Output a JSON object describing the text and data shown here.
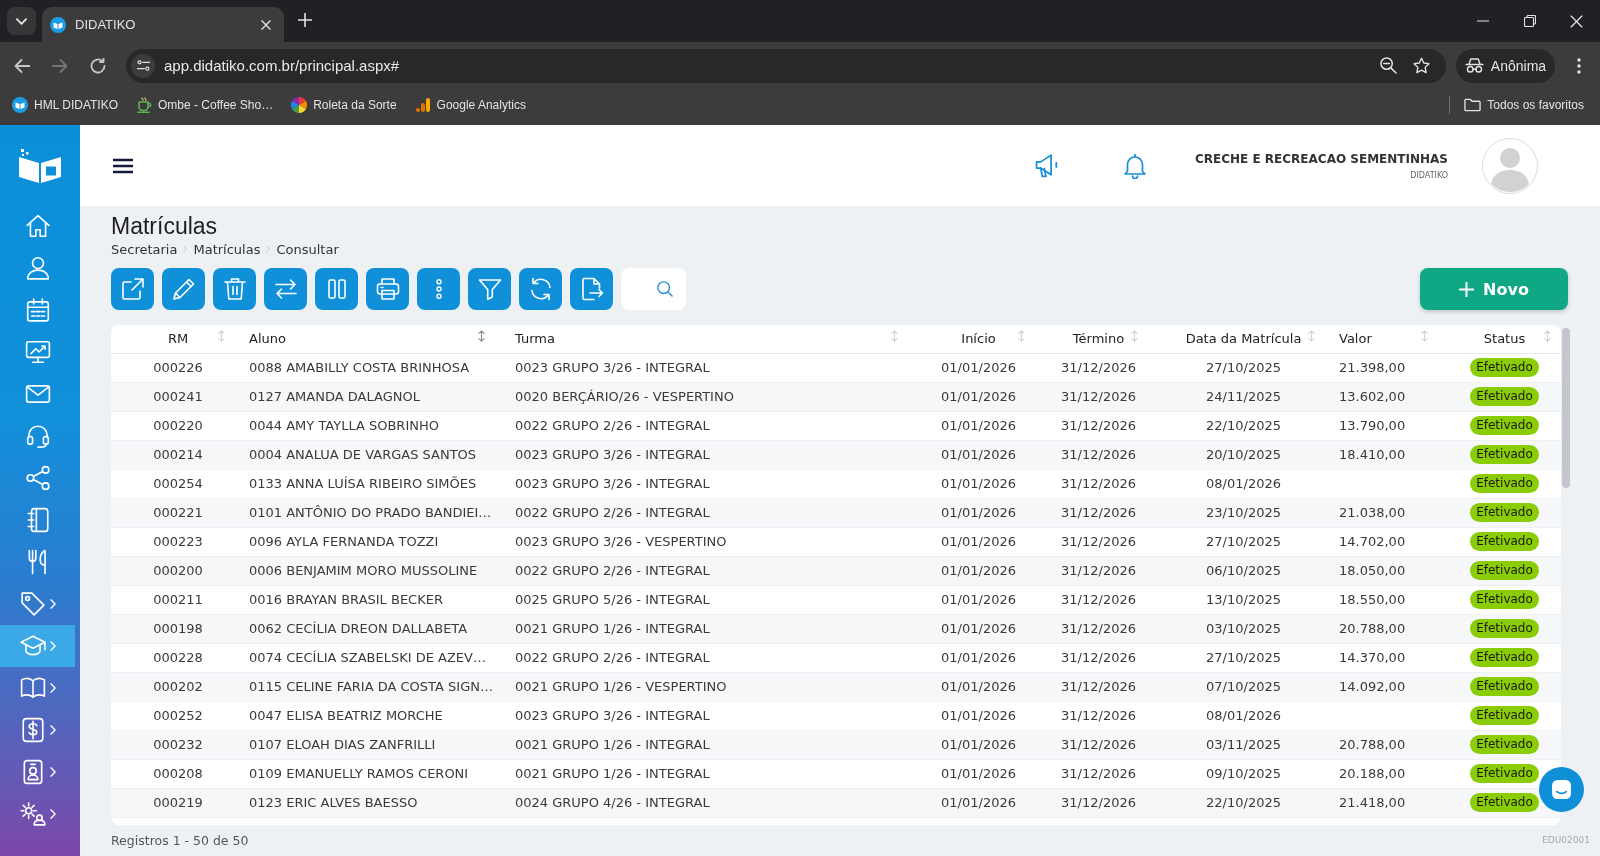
{
  "browser": {
    "tabs": [
      {
        "title": "DIDATIKO",
        "selected": true
      }
    ],
    "navigation": [
      {
        "kind": "back",
        "disabled": false
      },
      {
        "kind": "forward",
        "disabled": true
      },
      {
        "kind": "reload",
        "disabled": false
      }
    ],
    "address": "app.didatiko.com.br/principal.aspx#",
    "profile": "Anônima",
    "bookmarks": [
      {
        "label": "HML DIDATIKO",
        "kind": "app"
      },
      {
        "label": "Ombe - Coffee Sho…",
        "kind": "cup"
      },
      {
        "label": "Roleta da Sorte",
        "kind": "wheel"
      },
      {
        "label": "Google Analytics",
        "kind": "analytics"
      }
    ],
    "all_bookmarks": "Todos os favoritos"
  },
  "sidebar": {
    "items": [
      {
        "kind": "home",
        "selected": false,
        "submenu": false
      },
      {
        "kind": "user",
        "selected": false,
        "submenu": false
      },
      {
        "kind": "calendar",
        "selected": false,
        "submenu": false
      },
      {
        "kind": "dashboard",
        "selected": false,
        "submenu": false
      },
      {
        "kind": "mail",
        "selected": false,
        "submenu": false
      },
      {
        "kind": "support",
        "selected": false,
        "submenu": false
      },
      {
        "kind": "share",
        "selected": false,
        "submenu": false
      },
      {
        "kind": "notebook",
        "selected": false,
        "submenu": false
      },
      {
        "kind": "food",
        "selected": false,
        "submenu": false
      },
      {
        "kind": "tag",
        "selected": false,
        "submenu": true
      },
      {
        "kind": "academic",
        "selected": true,
        "submenu": true
      },
      {
        "kind": "library",
        "selected": false,
        "submenu": true
      },
      {
        "kind": "finance",
        "selected": false,
        "submenu": true
      },
      {
        "kind": "staff",
        "selected": false,
        "submenu": true
      },
      {
        "kind": "settings",
        "selected": false,
        "submenu": true
      }
    ]
  },
  "header": {
    "organization": "CRECHE E RECREACAO SEMENTINHAS",
    "subtitle": "DIDATIKO"
  },
  "page": {
    "title": "Matrículas",
    "breadcrumb": [
      "Secretaria",
      "Matrículas",
      "Consultar"
    ]
  },
  "toolbar": {
    "buttons": [
      {
        "kind": "open"
      },
      {
        "kind": "edit"
      },
      {
        "kind": "delete"
      },
      {
        "kind": "transfer"
      },
      {
        "kind": "columns"
      },
      {
        "kind": "print"
      },
      {
        "kind": "more"
      },
      {
        "kind": "filter"
      },
      {
        "kind": "refresh"
      },
      {
        "kind": "export"
      }
    ],
    "new_button": "Novo"
  },
  "table": {
    "columns": [
      {
        "label": "RM",
        "sorted": false
      },
      {
        "label": "Aluno",
        "sorted": true
      },
      {
        "label": "Turma",
        "sorted": false
      },
      {
        "label": "Início",
        "sorted": false
      },
      {
        "label": "Término",
        "sorted": false
      },
      {
        "label": "Data da Matrícula",
        "sorted": false
      },
      {
        "label": "Valor",
        "sorted": false
      },
      {
        "label": "Status",
        "sorted": false
      }
    ],
    "rows": [
      {
        "rm": "000226",
        "aluno": "0088 AMABILLY COSTA BRINHOSA",
        "turma": "0023 GRUPO 3/26 - INTEGRAL",
        "inicio": "01/01/2026",
        "termino": "31/12/2026",
        "data_matricula": "27/10/2025",
        "valor": "21.398,00",
        "status": "Efetivado"
      },
      {
        "rm": "000241",
        "aluno": "0127 AMANDA DALAGNOL",
        "turma": "0020 BERÇÁRIO/26 - VESPERTINO",
        "inicio": "01/01/2026",
        "termino": "31/12/2026",
        "data_matricula": "24/11/2025",
        "valor": "13.602,00",
        "status": "Efetivado"
      },
      {
        "rm": "000220",
        "aluno": "0044 AMY TAYLLA SOBRINHO",
        "turma": "0022 GRUPO 2/26 - INTEGRAL",
        "inicio": "01/01/2026",
        "termino": "31/12/2026",
        "data_matricula": "22/10/2025",
        "valor": "13.790,00",
        "status": "Efetivado"
      },
      {
        "rm": "000214",
        "aluno": "0004 ANALUA DE VARGAS SANTOS",
        "turma": "0023 GRUPO 3/26 - INTEGRAL",
        "inicio": "01/01/2026",
        "termino": "31/12/2026",
        "data_matricula": "20/10/2025",
        "valor": "18.410,00",
        "status": "Efetivado"
      },
      {
        "rm": "000254",
        "aluno": "0133 ANNA LUÍSA RIBEIRO SIMÕES",
        "turma": "0023 GRUPO 3/26 - INTEGRAL",
        "inicio": "01/01/2026",
        "termino": "31/12/2026",
        "data_matricula": "08/01/2026",
        "status": "Efetivado"
      },
      {
        "rm": "000221",
        "aluno": "0101 ANTÔNIO DO PRADO BANDIEI…",
        "turma": "0022 GRUPO 2/26 - INTEGRAL",
        "inicio": "01/01/2026",
        "termino": "31/12/2026",
        "data_matricula": "23/10/2025",
        "valor": "21.038,00",
        "status": "Efetivado"
      },
      {
        "rm": "000223",
        "aluno": "0096 AYLA FERNANDA TOZZI",
        "turma": "0023 GRUPO 3/26 - VESPERTINO",
        "inicio": "01/01/2026",
        "termino": "31/12/2026",
        "data_matricula": "27/10/2025",
        "valor": "14.702,00",
        "status": "Efetivado"
      },
      {
        "rm": "000200",
        "aluno": "0006 BENJAMIM MORO MUSSOLINE",
        "turma": "0022 GRUPO 2/26 - INTEGRAL",
        "inicio": "01/01/2026",
        "termino": "31/12/2026",
        "data_matricula": "06/10/2025",
        "valor": "18.050,00",
        "status": "Efetivado"
      },
      {
        "rm": "000211",
        "aluno": "0016 BRAYAN BRASIL BECKER",
        "turma": "0025 GRUPO 5/26 - INTEGRAL",
        "inicio": "01/01/2026",
        "termino": "31/12/2026",
        "data_matricula": "13/10/2025",
        "valor": "18.550,00",
        "status": "Efetivado"
      },
      {
        "rm": "000198",
        "aluno": "0062 CECÍLIA DREON DALLABETA",
        "turma": "0021 GRUPO 1/26 - INTEGRAL",
        "inicio": "01/01/2026",
        "termino": "31/12/2026",
        "data_matricula": "03/10/2025",
        "valor": "20.788,00",
        "status": "Efetivado"
      },
      {
        "rm": "000228",
        "aluno": "0074 CECÍLIA SZABELSKI DE AZEV…",
        "turma": "0022 GRUPO 2/26 - INTEGRAL",
        "inicio": "01/01/2026",
        "termino": "31/12/2026",
        "data_matricula": "27/10/2025",
        "valor": "14.370,00",
        "status": "Efetivado"
      },
      {
        "rm": "000202",
        "aluno": "0115 CELINE FARIA DA COSTA SIGN…",
        "turma": "0021 GRUPO 1/26 - VESPERTINO",
        "inicio": "01/01/2026",
        "termino": "31/12/2026",
        "data_matricula": "07/10/2025",
        "valor": "14.092,00",
        "status": "Efetivado"
      },
      {
        "rm": "000252",
        "aluno": "0047 ELISA BEATRIZ MORCHE",
        "turma": "0023 GRUPO 3/26 - INTEGRAL",
        "inicio": "01/01/2026",
        "termino": "31/12/2026",
        "data_matricula": "08/01/2026",
        "status": "Efetivado"
      },
      {
        "rm": "000232",
        "aluno": "0107 ELOAH DIAS ZANFRILLI",
        "turma": "0021 GRUPO 1/26 - INTEGRAL",
        "inicio": "01/01/2026",
        "termino": "31/12/2026",
        "data_matricula": "03/11/2025",
        "valor": "20.788,00",
        "status": "Efetivado"
      },
      {
        "rm": "000208",
        "aluno": "0109 EMANUELLY RAMOS CERONI",
        "turma": "0021 GRUPO 1/26 - INTEGRAL",
        "inicio": "01/01/2026",
        "termino": "31/12/2026",
        "data_matricula": "09/10/2025",
        "valor": "20.188,00",
        "status": "Efetivado"
      },
      {
        "rm": "000219",
        "aluno": "0123 ERIC ALVES BAESSO",
        "turma": "0024 GRUPO 4/26 - INTEGRAL",
        "inicio": "01/01/2026",
        "termino": "31/12/2026",
        "data_matricula": "22/10/2025",
        "valor": "21.418,00",
        "status": "Efetivado"
      }
    ]
  },
  "footer": {
    "records": "Registros 1 - 50 de 50",
    "screen_code": "EDU02001"
  }
}
